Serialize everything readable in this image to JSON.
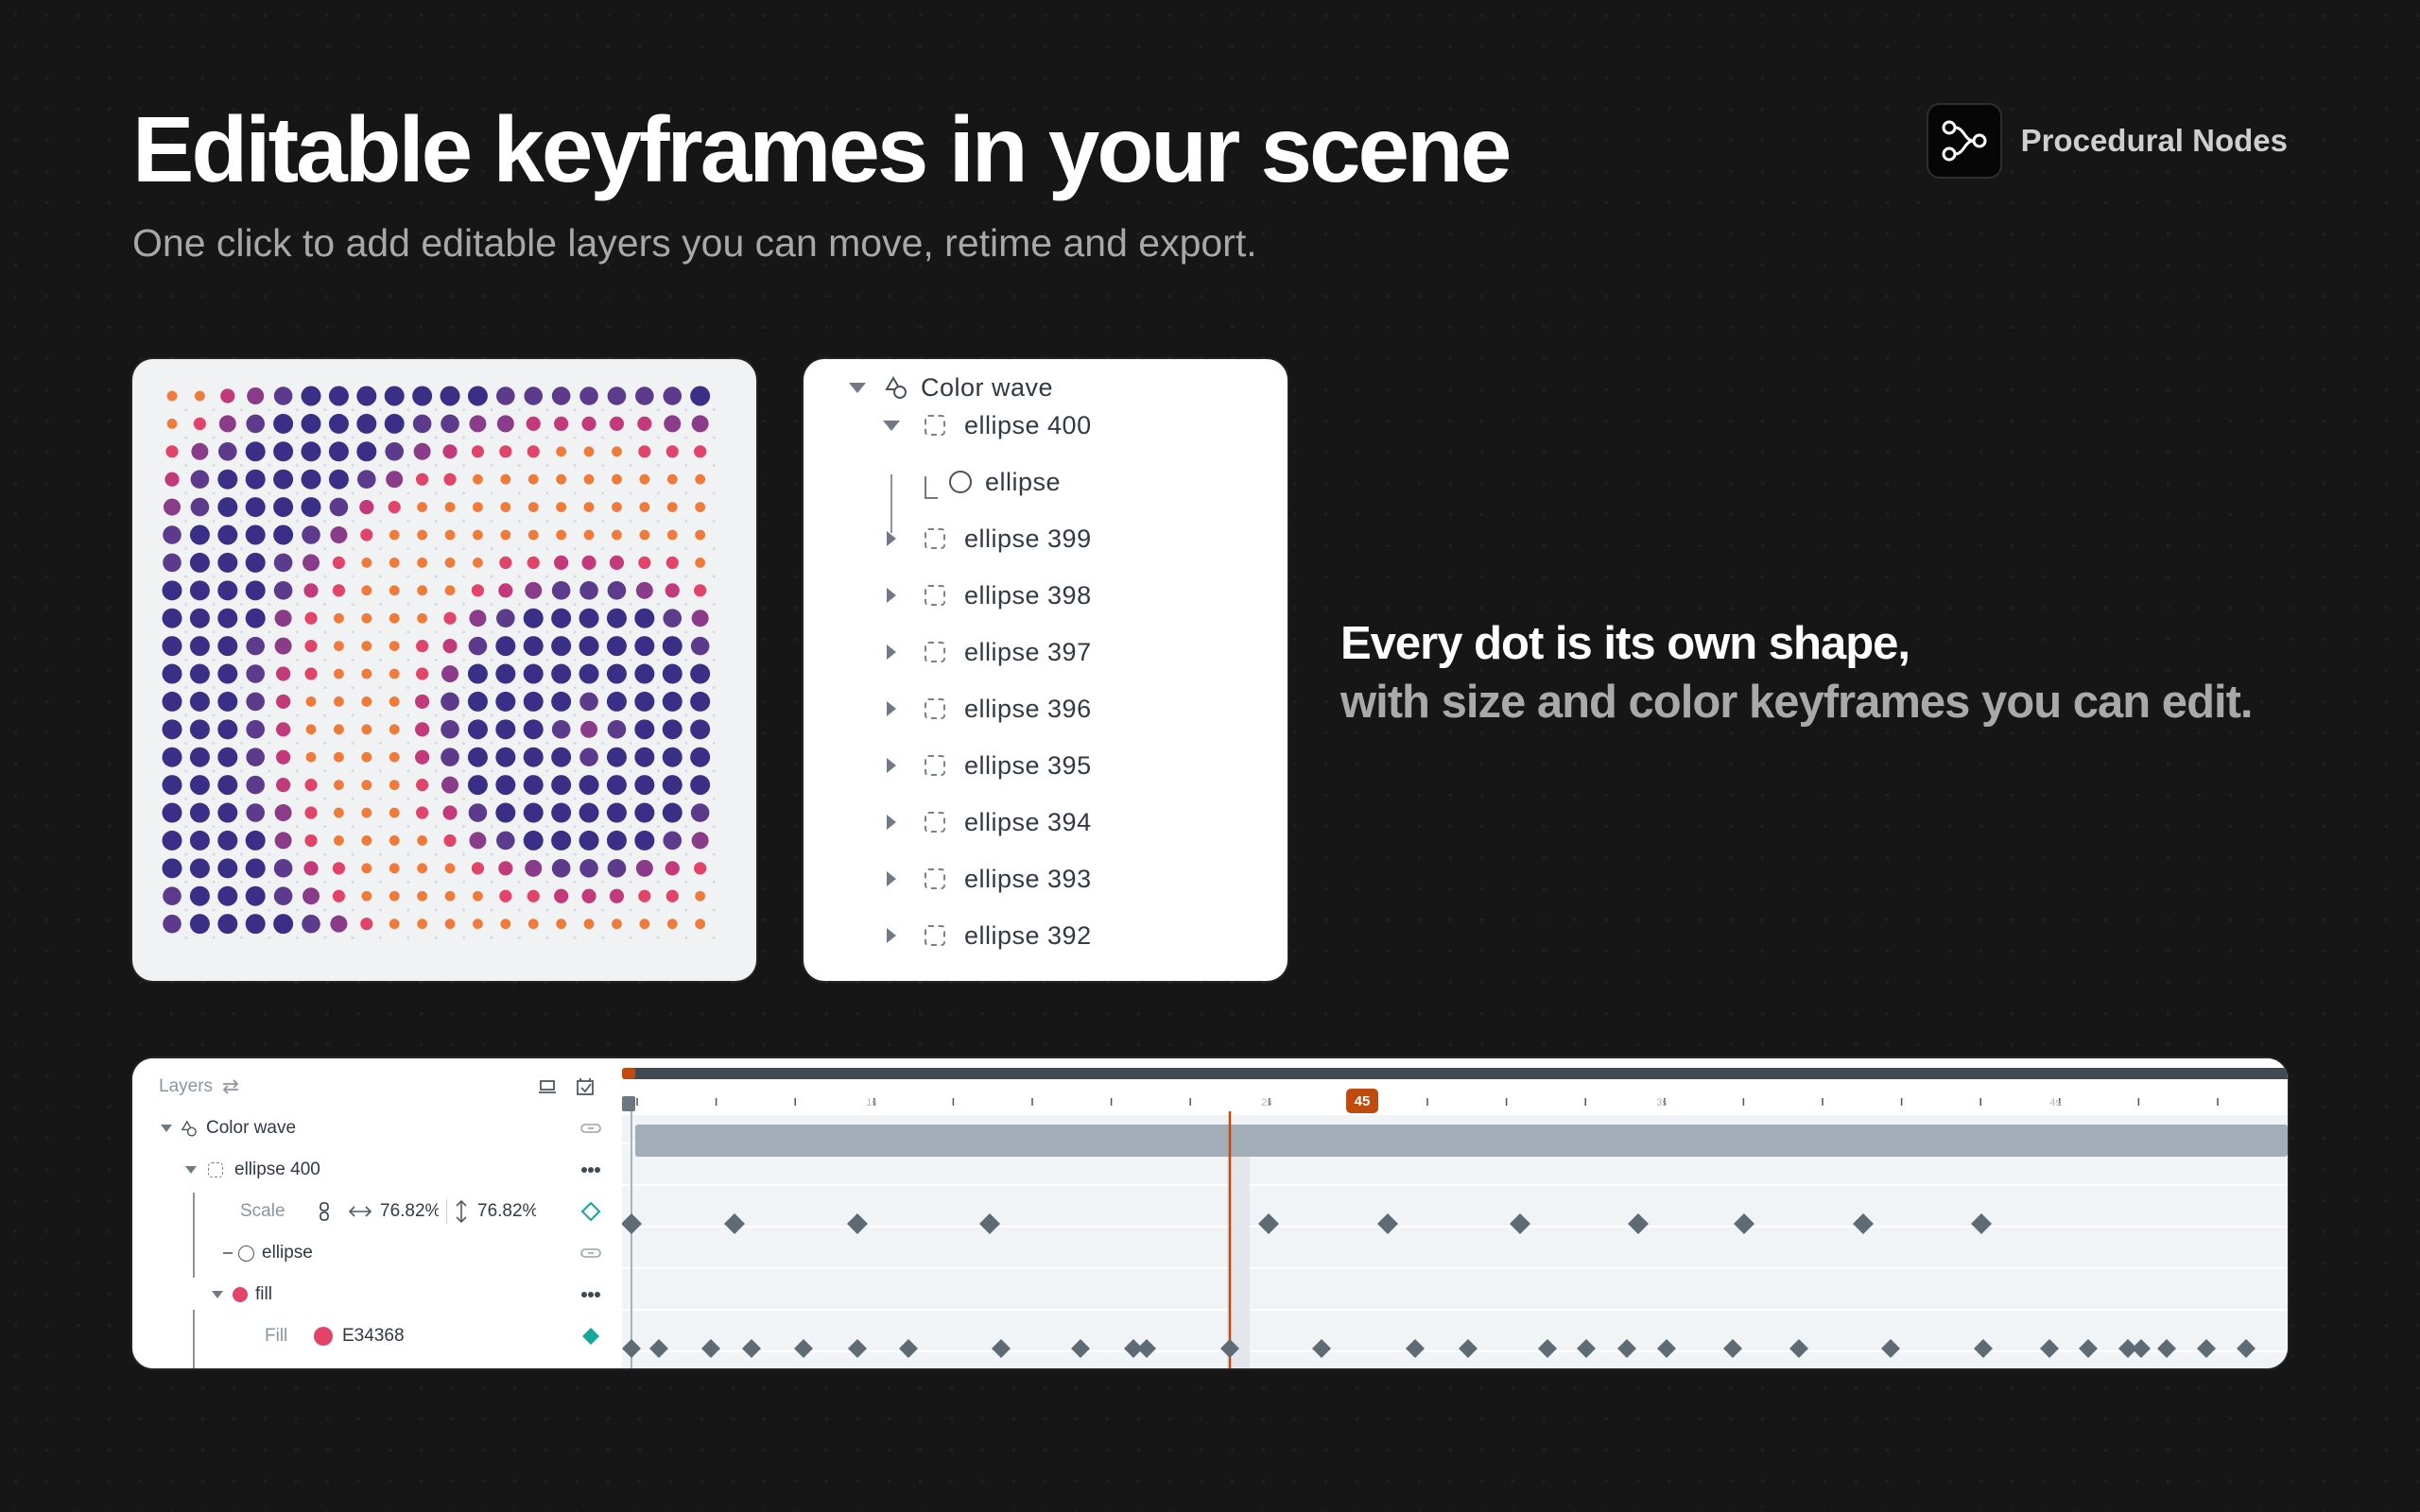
{
  "hero": {
    "title": "Editable keyframes in your scene",
    "subtitle": "One click to add editable layers you can move, retime and export."
  },
  "brand": {
    "name": "Procedural Nodes",
    "icon": "node-graph-icon"
  },
  "tree": {
    "root": "Color wave",
    "expanded": "ellipse 400",
    "child": "ellipse",
    "items": [
      "ellipse 399",
      "ellipse 398",
      "ellipse 397",
      "ellipse 396",
      "ellipse 395",
      "ellipse 394",
      "ellipse 393",
      "ellipse 392"
    ]
  },
  "description": {
    "line1": "Every dot is its own shape,",
    "line2": "with size and color keyframes you can edit."
  },
  "timeline": {
    "panel_title": "Layers",
    "rows": {
      "group": "Color wave",
      "layer": "ellipse 400",
      "scale_label": "Scale",
      "scale_x": "76.82%",
      "scale_y": "76.82%",
      "shape": "ellipse",
      "fill_group": "fill",
      "fill_label": "Fill",
      "fill_hex": "E34368"
    },
    "playhead_frame": "45",
    "ruler_labels": [
      "1s",
      "2s",
      "3s",
      "4s"
    ],
    "colors": {
      "playhead": "#c14a0e",
      "fill": "#e34368",
      "keyframe": "#5e6a74",
      "accent": "#14a89a"
    }
  },
  "palette": {
    "dots": [
      "#e2436a",
      "#f07a3a",
      "#8a3b89",
      "#5c3b8c",
      "#3a2f86",
      "#c23a7a"
    ]
  }
}
